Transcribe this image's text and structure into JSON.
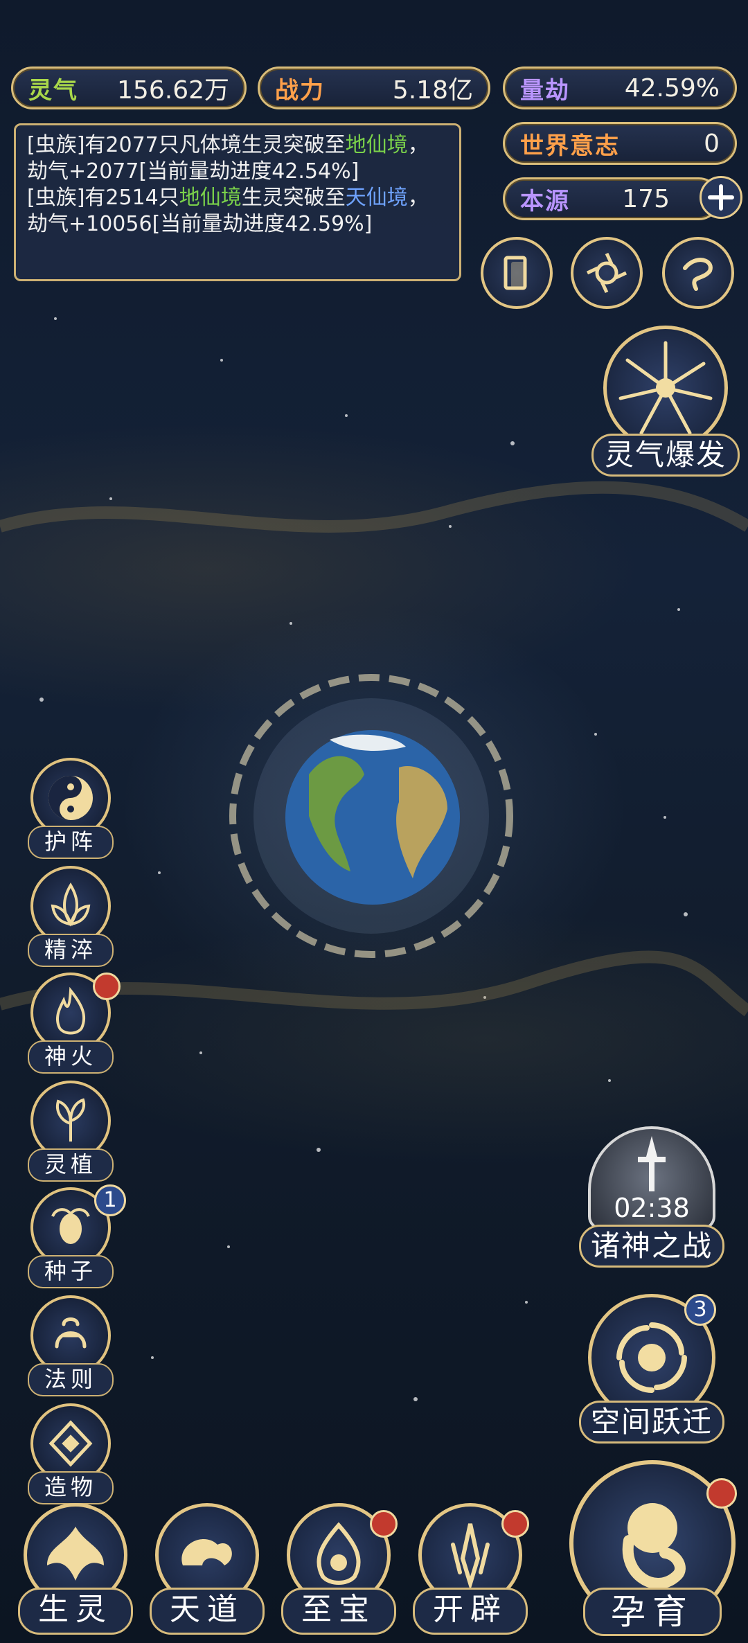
{
  "top_stats": {
    "lingqi": {
      "label": "灵气",
      "value": "156.62万"
    },
    "zhanli": {
      "label": "战力",
      "value": "5.18亿"
    },
    "liangjie": {
      "label": "量劫",
      "value": "42.59%"
    },
    "world_will": {
      "label": "世界意志",
      "value": "0"
    },
    "benyuan": {
      "label": "本源",
      "value": "175"
    }
  },
  "log": {
    "line1_a": "[虫族]有2077只凡体境生灵突破至",
    "line1_realm": "地仙境",
    "line1_b": "，劫气+2077[当前量劫进度42.54%]",
    "line2_a": "[虫族]有2514只",
    "line2_realm1": "地仙境",
    "line2_b": "生灵突破至",
    "line2_realm2": "天仙境",
    "line2_c": "，劫气+10056[当前量劫进度42.59%]"
  },
  "right_panel": {
    "burst_label": "灵气爆发",
    "war_timer": "02:38",
    "war_label": "诸神之战",
    "leap_label": "空间跃迁",
    "leap_count": "3",
    "breed_label": "孕育"
  },
  "sidebar": {
    "items": [
      {
        "label": "护阵",
        "icon": "yin-yang-icon"
      },
      {
        "label": "精淬",
        "icon": "lotus-flame-icon"
      },
      {
        "label": "神火",
        "icon": "divine-fire-icon"
      },
      {
        "label": "灵植",
        "icon": "spirit-plant-icon"
      },
      {
        "label": "种子",
        "icon": "seed-icon",
        "count": "1"
      },
      {
        "label": "法则",
        "icon": "law-icon"
      },
      {
        "label": "造物",
        "icon": "creation-icon"
      }
    ]
  },
  "bottom_nav": {
    "items": [
      {
        "label": "生灵"
      },
      {
        "label": "天道"
      },
      {
        "label": "至宝"
      },
      {
        "label": "开辟"
      }
    ]
  },
  "colors": {
    "gold": "#d9bd7a",
    "green": "#7ad14a",
    "blue": "#6fa3ff",
    "badge_red": "#c23a2e"
  }
}
